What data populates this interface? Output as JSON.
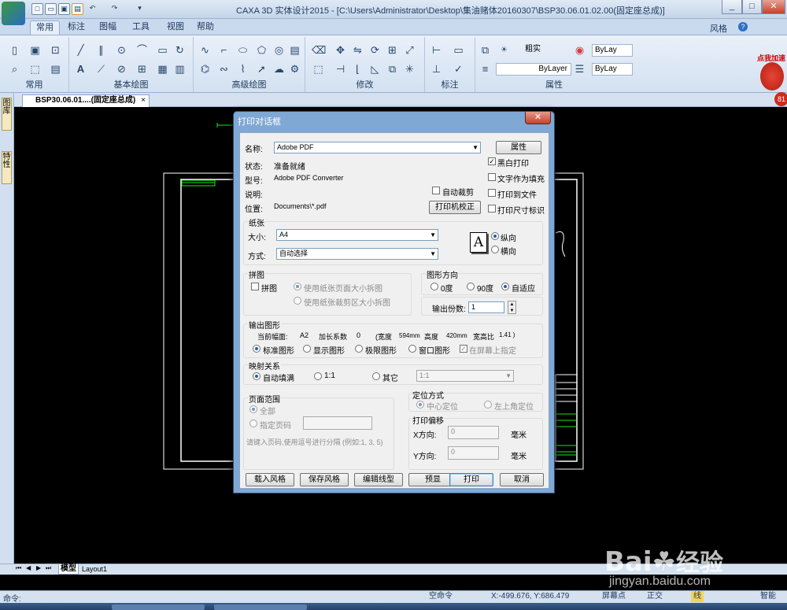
{
  "window": {
    "title": "CAXA 3D 实体设计2015 - [C:\\Users\\Administrator\\Desktop\\集油赌体20160307\\BSP30.06.01.02.00(固定座总成)]",
    "style_label": "风格",
    "min": "_",
    "max": "□",
    "close": "✕"
  },
  "ribbon": {
    "tabs": [
      "常用",
      "标注",
      "图幅",
      "工具",
      "视图",
      "帮助"
    ],
    "groups": [
      "常用",
      "基本绘图",
      "高级绘图",
      "修改",
      "标注",
      "属性"
    ],
    "layer_value": "粗实",
    "bylayer_1": "ByLay",
    "bylayer_2": "ByLayer",
    "bylayer_3": "ByLay"
  },
  "promo": {
    "badge": "点我加速",
    "number": "81"
  },
  "doc_tab": "BSP30.06.01....(固定座总成)",
  "sidebar": [
    "图库",
    "特性"
  ],
  "layout_tabs": [
    "模型",
    "Layout1"
  ],
  "command": {
    "prompt": "命令:"
  },
  "status": {
    "empty_cmd": "空命令",
    "coords": "X:-499.676, Y:686.479",
    "snap": "屏幕点",
    "ortho": "正交",
    "linewidth": "线",
    "smart": "智能"
  },
  "watermark": {
    "brand": "Bai",
    "brand2": "经验",
    "url": "jingyan.baidu.com"
  },
  "dialog": {
    "title": "打印对话框",
    "printer": {
      "name_label": "名称:",
      "name_value": "Adobe PDF",
      "properties_btn": "属性",
      "status_label": "状态:",
      "status_value": "准备就绪",
      "type_label": "型号:",
      "type_value": "Adobe PDF Converter",
      "comment_label": "说明:",
      "location_label": "位置:",
      "location_value": "Documents\\*.pdf",
      "auto_crop": "自动裁剪",
      "calibrate_btn": "打印机校正"
    },
    "options": {
      "black_white": "黑白打印",
      "text_as_fill": "文字作为填充",
      "print_to_file": "打印到文件",
      "print_size_marks": "打印尺寸标识"
    },
    "paper": {
      "title": "纸张",
      "size_label": "大小:",
      "size_value": "A4",
      "mode_label": "方式:",
      "mode_value": "自动选择",
      "portrait": "纵向",
      "landscape": "横向",
      "icon": "A"
    },
    "tile": {
      "title": "拼图",
      "tile_chk": "拼图",
      "opt1": "使用纸张页面大小拆图",
      "opt2": "使用纸张裁剪区大小拆图"
    },
    "orientation": {
      "title": "图形方向",
      "deg0": "0度",
      "deg90": "90度",
      "auto": "自适应",
      "copies_label": "输出份数:",
      "copies_value": "1"
    },
    "output": {
      "title": "输出图形",
      "current_label": "当前幅面:",
      "current_value": "A2",
      "factor_label": "加长系数",
      "factor_value": "0",
      "width_label": "(宽度",
      "width_value": "594mm",
      "height_label": "高度",
      "height_value": "420mm",
      "ratio_label": "宽高比",
      "ratio_value": "1.41 )",
      "std": "标准图形",
      "disp": "显示图形",
      "limits": "极限图形",
      "window": "窗口图形",
      "on_screen": "在屏幕上指定"
    },
    "mapping": {
      "title": "映射关系",
      "fill": "自动填满",
      "one": "1:1",
      "other": "其它",
      "other_value": "1:1"
    },
    "page_range": {
      "title": "页面范围",
      "all": "全部",
      "pages": "指定页码",
      "hint": "请键入页码,使用逗号进行分隔 (例如:1, 3, 5)"
    },
    "position": {
      "title": "定位方式",
      "center": "中心定位",
      "topleft": "左上角定位"
    },
    "offset": {
      "title": "打印偏移",
      "x_label": "X方向:",
      "x_value": "0",
      "y_label": "Y方向:",
      "y_value": "0",
      "unit": "毫米"
    },
    "buttons": {
      "load_style": "载入风格",
      "save_style": "保存风格",
      "edit_linetype": "编辑线型",
      "preview": "预显",
      "print": "打印",
      "cancel": "取消"
    }
  }
}
